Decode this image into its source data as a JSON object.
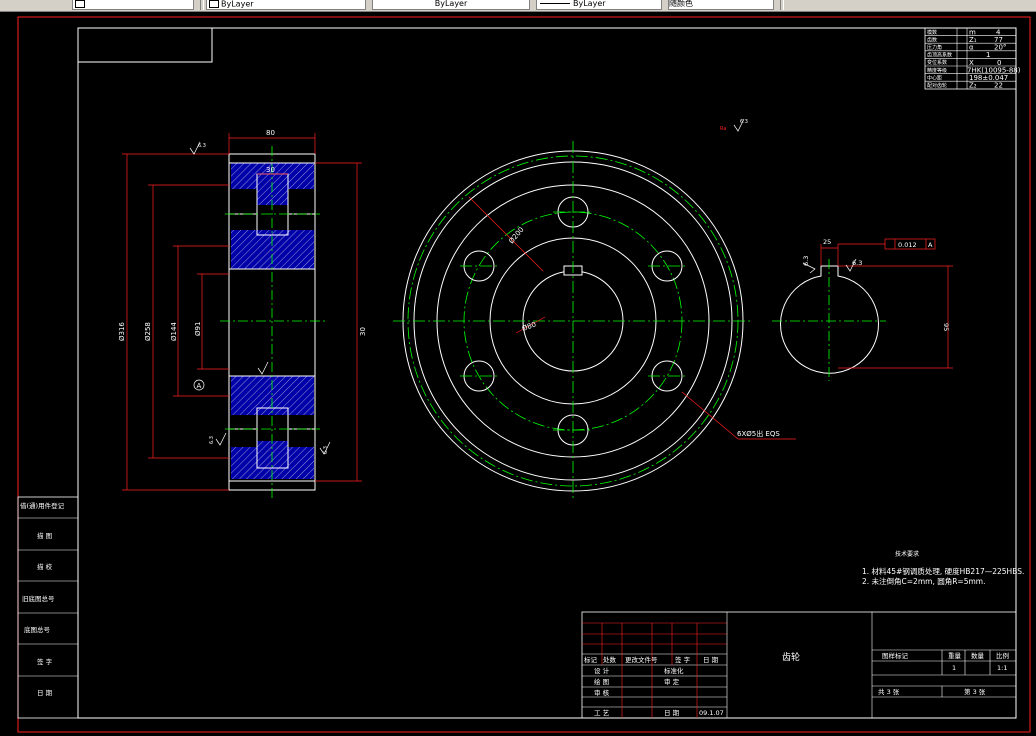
{
  "toolbar": {
    "linetype1": "ByLayer",
    "linetype2": "ByLayer",
    "lineweight": "ByLayer",
    "plotstyle": "随颜色"
  },
  "colors": {
    "background": "#000000",
    "white": "#ffffff",
    "red": "#ff2020",
    "green": "#00ff00",
    "hatch": "#0000a8"
  },
  "gear_params": {
    "rows": [
      {
        "label": "模数",
        "symbol": "m",
        "value": "4"
      },
      {
        "label": "齿数",
        "symbol": "Z₁",
        "value": "77"
      },
      {
        "label": "压力角",
        "symbol": "α",
        "value": "20°"
      },
      {
        "label": "齿顶高系数",
        "symbol": "",
        "value": "1"
      },
      {
        "label": "变位系数",
        "symbol": "X",
        "value": "0"
      },
      {
        "label": "精度等级",
        "symbol": "",
        "value": "7HK(10095-88)"
      },
      {
        "label": "中心距",
        "symbol": "",
        "value": "198±0.047"
      },
      {
        "label": "配对齿轮",
        "symbol": "Z₂",
        "value": "22"
      }
    ]
  },
  "dimensions": {
    "width": "80",
    "width_inner": "30",
    "dia_outer": "Ø316",
    "dia_pitch": "Ø258",
    "dia_hub": "Ø144",
    "dia_bore": "Ø91",
    "dia_hole_circle": "Ø200",
    "dia_small": "Ø80",
    "holes": "6XØ5出 EQS",
    "key_width": "25",
    "key_depth": "95",
    "tolerance": "0.012",
    "datum": "A",
    "ra1": "Ra",
    "rough_label": "Ra",
    "rough_val": "6.3",
    "rough_val2": "3.2",
    "rough_val3": "1.6"
  },
  "tech_req": {
    "title": "技术要求",
    "line1": "1. 材料45#钢调质处理, 硬度HB217—225HBS.",
    "line2": "2. 未注倒角C=2mm, 圆角R=5mm."
  },
  "side_table": {
    "rows": [
      "借(通)用件登记",
      "描 图",
      "描 校",
      "旧底图总号",
      "底图总号",
      "签 字",
      "日 期"
    ]
  },
  "title_block": {
    "name": "齿轮",
    "hdr_mark": "标记",
    "hdr_count": "处数",
    "hdr_file": "更改文件号",
    "hdr_sign": "签 字",
    "hdr_date": "日 期",
    "design": "设 计",
    "standard": "标准化",
    "draw": "绘 图",
    "review": "审 定",
    "check": "审 核",
    "process": "工 艺",
    "date_label": "日 期",
    "date_value": "09.1.07",
    "stage": "图样标记",
    "weight": "重量",
    "scale": "比例",
    "qty": "数量",
    "qty_value": "1",
    "scale_value": "1:1",
    "sheets_total": "共 3 张",
    "sheet_no": "第 3 张"
  }
}
